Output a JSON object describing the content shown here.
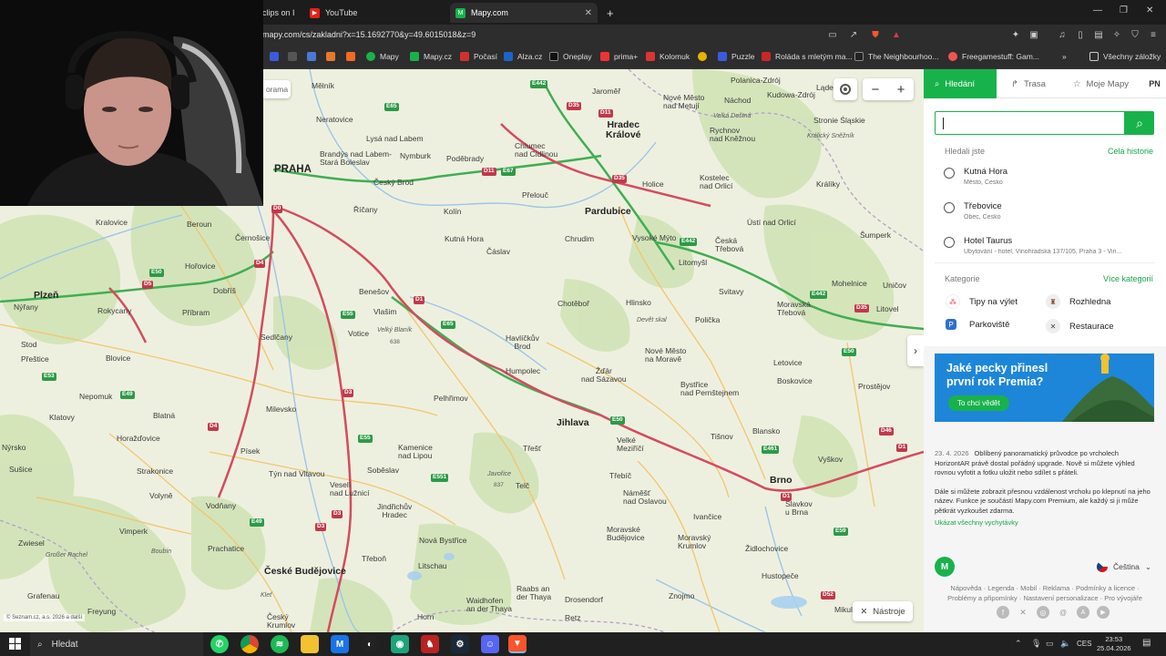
{
  "browser": {
    "tabs": [
      {
        "label": "clips on I"
      },
      {
        "label": "YouTube"
      },
      {
        "label": "Mapy.com"
      }
    ],
    "url": "mapy.com/cs/zakladni?x=15.1692770&y=49.6015018&z=9",
    "bookmarks": [
      {
        "label": "Mapy"
      },
      {
        "label": "Mapy.cz"
      },
      {
        "label": "Počasí"
      },
      {
        "label": "Alza.cz"
      },
      {
        "label": "Oneplay"
      },
      {
        "label": "prima+"
      },
      {
        "label": "Kolomuk"
      },
      {
        "label": "Puzzle"
      },
      {
        "label": "Roláda s mletým ma..."
      },
      {
        "label": "The Neighbourhoo..."
      },
      {
        "label": "Freegamestuff: Gam..."
      }
    ],
    "bookmarks_other": "Všechny záložky"
  },
  "map": {
    "towns": [
      {
        "name": "Mělník"
      },
      {
        "name": "Neratovice"
      },
      {
        "name": "Lysá nad Labem"
      },
      {
        "name": "Brandýs nad Labem-\nStará Boleslav"
      },
      {
        "name": "PRAHA"
      },
      {
        "name": "Nymburk"
      },
      {
        "name": "Poděbrady"
      },
      {
        "name": "Chlumec\nnad Cidlinou"
      },
      {
        "name": "Jaroměř"
      },
      {
        "name": "Hradec\nKrálové"
      },
      {
        "name": "Polanica-Zdrój"
      },
      {
        "name": "Kudowa-Zdrój"
      },
      {
        "name": "Náchod"
      },
      {
        "name": "Nové Město\nnad Metují"
      },
      {
        "name": "Rychnov\nnad Kněžnou"
      },
      {
        "name": "Stronie Śląskie"
      },
      {
        "name": "Český Brod"
      },
      {
        "name": "Přelouč"
      },
      {
        "name": "Holice"
      },
      {
        "name": "Kostelec\nnad Orlicí"
      },
      {
        "name": "Králíky"
      },
      {
        "name": "Říčany"
      },
      {
        "name": "Kolín"
      },
      {
        "name": "Pardubice"
      },
      {
        "name": "Ústí nad Orlicí"
      },
      {
        "name": "Kralovice"
      },
      {
        "name": "Beroun"
      },
      {
        "name": "Černošice"
      },
      {
        "name": "Kutná Hora"
      },
      {
        "name": "Čáslav"
      },
      {
        "name": "Chrudim"
      },
      {
        "name": "Vysoké Mýto"
      },
      {
        "name": "Česká\nTřebová"
      },
      {
        "name": "Šumperk"
      },
      {
        "name": "Litomyšl"
      },
      {
        "name": "Hořovice"
      },
      {
        "name": "Dobříš"
      },
      {
        "name": "Benešov"
      },
      {
        "name": "Plzeň"
      },
      {
        "name": "Nýřany"
      },
      {
        "name": "Rokycany"
      },
      {
        "name": "Příbram"
      },
      {
        "name": "Vlašim"
      },
      {
        "name": "Chotěboř"
      },
      {
        "name": "Hlinsko"
      },
      {
        "name": "Svitavy"
      },
      {
        "name": "Mohelnice"
      },
      {
        "name": "Uničov"
      },
      {
        "name": "Moravská\nTřebová"
      },
      {
        "name": "Litovel"
      },
      {
        "name": "Stod"
      },
      {
        "name": "Sedlčany"
      },
      {
        "name": "Votice"
      },
      {
        "name": "Havlíčkův\nBrod"
      },
      {
        "name": "Nové Město\nna Moravě"
      },
      {
        "name": "Polička"
      },
      {
        "name": "Přeštice"
      },
      {
        "name": "Blovice"
      },
      {
        "name": "Humpolec"
      },
      {
        "name": "Žďár\nnad Sázavou"
      },
      {
        "name": "Letovice"
      },
      {
        "name": "Nepomuk"
      },
      {
        "name": "Bystřice\nnad Pernštejnem"
      },
      {
        "name": "Boskovice"
      },
      {
        "name": "Prostějov"
      },
      {
        "name": "Milevsko"
      },
      {
        "name": "Pelhřimov"
      },
      {
        "name": "Klatovy"
      },
      {
        "name": "Blatná"
      },
      {
        "name": "Jihlava"
      },
      {
        "name": "Velké\nMeziříčí"
      },
      {
        "name": "Blansko"
      },
      {
        "name": "Horažďovice"
      },
      {
        "name": "Tišnov"
      },
      {
        "name": "Nýrsko"
      },
      {
        "name": "Písek"
      },
      {
        "name": "Kamenice\nnad Lipou"
      },
      {
        "name": "Třešť"
      },
      {
        "name": "Vyškov"
      },
      {
        "name": "Sušice"
      },
      {
        "name": "Strakonice"
      },
      {
        "name": "Týn nad Vltavou"
      },
      {
        "name": "Soběslav"
      },
      {
        "name": "Brno"
      },
      {
        "name": "Třebíč"
      },
      {
        "name": "Volyně"
      },
      {
        "name": "Telč"
      },
      {
        "name": "Vodňany"
      },
      {
        "name": "Veselí\nnad Lužnicí"
      },
      {
        "name": "Náměšť\nnad Oslavou"
      },
      {
        "name": "Slavkov\nu Brna"
      },
      {
        "name": "Jindřichův\nHradec"
      },
      {
        "name": "Ivančice"
      },
      {
        "name": "Vimperk"
      },
      {
        "name": "Zwiesel"
      },
      {
        "name": "Prachatice"
      },
      {
        "name": "Nová Bystřice"
      },
      {
        "name": "Moravské\nBudějovice"
      },
      {
        "name": "Moravský\nKrumlov"
      },
      {
        "name": "Židlochovice"
      },
      {
        "name": "Třeboň"
      },
      {
        "name": "České Budějovice"
      },
      {
        "name": "Litschau"
      },
      {
        "name": "Hustopeče"
      },
      {
        "name": "Grafenau"
      },
      {
        "name": "Freyung"
      },
      {
        "name": "Český\nKrumlov"
      },
      {
        "name": "Raabs an\nder Thaya"
      },
      {
        "name": "Drosendorf"
      },
      {
        "name": "Znojmo"
      },
      {
        "name": "Mikulov"
      },
      {
        "name": "Waidhofen\nan der Thaya"
      },
      {
        "name": "Retz"
      },
      {
        "name": "Horn"
      }
    ],
    "peaks": [
      {
        "name": "Velký Blaník",
        "elev": "638"
      },
      {
        "name": "Devět skal"
      },
      {
        "name": "Javořice",
        "elev": "837"
      },
      {
        "name": "Velká Deštná"
      },
      {
        "name": "Králický Sněžník"
      },
      {
        "name": "Boubín"
      },
      {
        "name": "Großer Rachel"
      },
      {
        "name": "Kleť"
      }
    ],
    "roads": [
      "E442",
      "D35",
      "D11",
      "D11",
      "E67",
      "D35",
      "E65",
      "D0",
      "E50",
      "D4",
      "D5",
      "D1",
      "E55",
      "E65",
      "E442",
      "E442",
      "D35",
      "E50",
      "D3",
      "E49",
      "E53",
      "D4",
      "D3",
      "E50",
      "D1",
      "E461",
      "E55",
      "E551",
      "E49",
      "D3",
      "D52",
      "D46",
      "D1",
      "E59"
    ],
    "partial_search_text": "orama",
    "scale_text": "© Seznam.cz, a.s. 2026 a další",
    "tools_label": "Nástroje"
  },
  "panel": {
    "tabs": [
      {
        "label": "Hledání"
      },
      {
        "label": "Trasa"
      },
      {
        "label": "Moje Mapy"
      }
    ],
    "avatar": "PN",
    "history_title": "Hledali jste",
    "history_link": "Celá historie",
    "history": [
      {
        "name": "Kutná Hora",
        "sub": "Město, Česko"
      },
      {
        "name": "Třebovice",
        "sub": "Obec, Česko"
      },
      {
        "name": "Hotel Taurus",
        "sub": "Ubytování - hotel, Vinohradská 137/105, Praha 3 - Vin..."
      }
    ],
    "categories_title": "Kategorie",
    "categories_link": "Více kategorií",
    "categories": [
      {
        "label": "Tipy na výlet"
      },
      {
        "label": "Rozhledna"
      },
      {
        "label": "Parkoviště"
      },
      {
        "label": "Restaurace"
      }
    ],
    "promo": {
      "title": "Jaké pecky přinesl\nprvní rok Premia?",
      "button": "To chci vědět"
    },
    "news": {
      "date": "23. 4. 2026",
      "p1": "Oblíbený panoramatický průvodce po vrcholech HorizontAR právě dostal pořádný upgrade. Nově si můžete výhled rovnou vyfotit a fotku uložit nebo sdílet s přáteli.",
      "p2": "Dále si můžete zobrazit přesnou vzdálenost vrcholu po klepnutí na jeho název. Funkce je součástí Mapy.com Premium, ale každý si ji může pětkrát vyzkoušet zdarma.",
      "link": "Ukázat všechny vychytávky"
    },
    "lang": "Čeština",
    "footer1": "Nápověda · Legenda · Mobil · Reklama · Podmínky a licence ·",
    "footer2": "Problémy a připomínky · Nastavení personalizace · Pro vývojáře"
  },
  "taskbar": {
    "search": "Hledat",
    "lang": "CES",
    "time": "23:53",
    "date": "25.04.2026"
  }
}
